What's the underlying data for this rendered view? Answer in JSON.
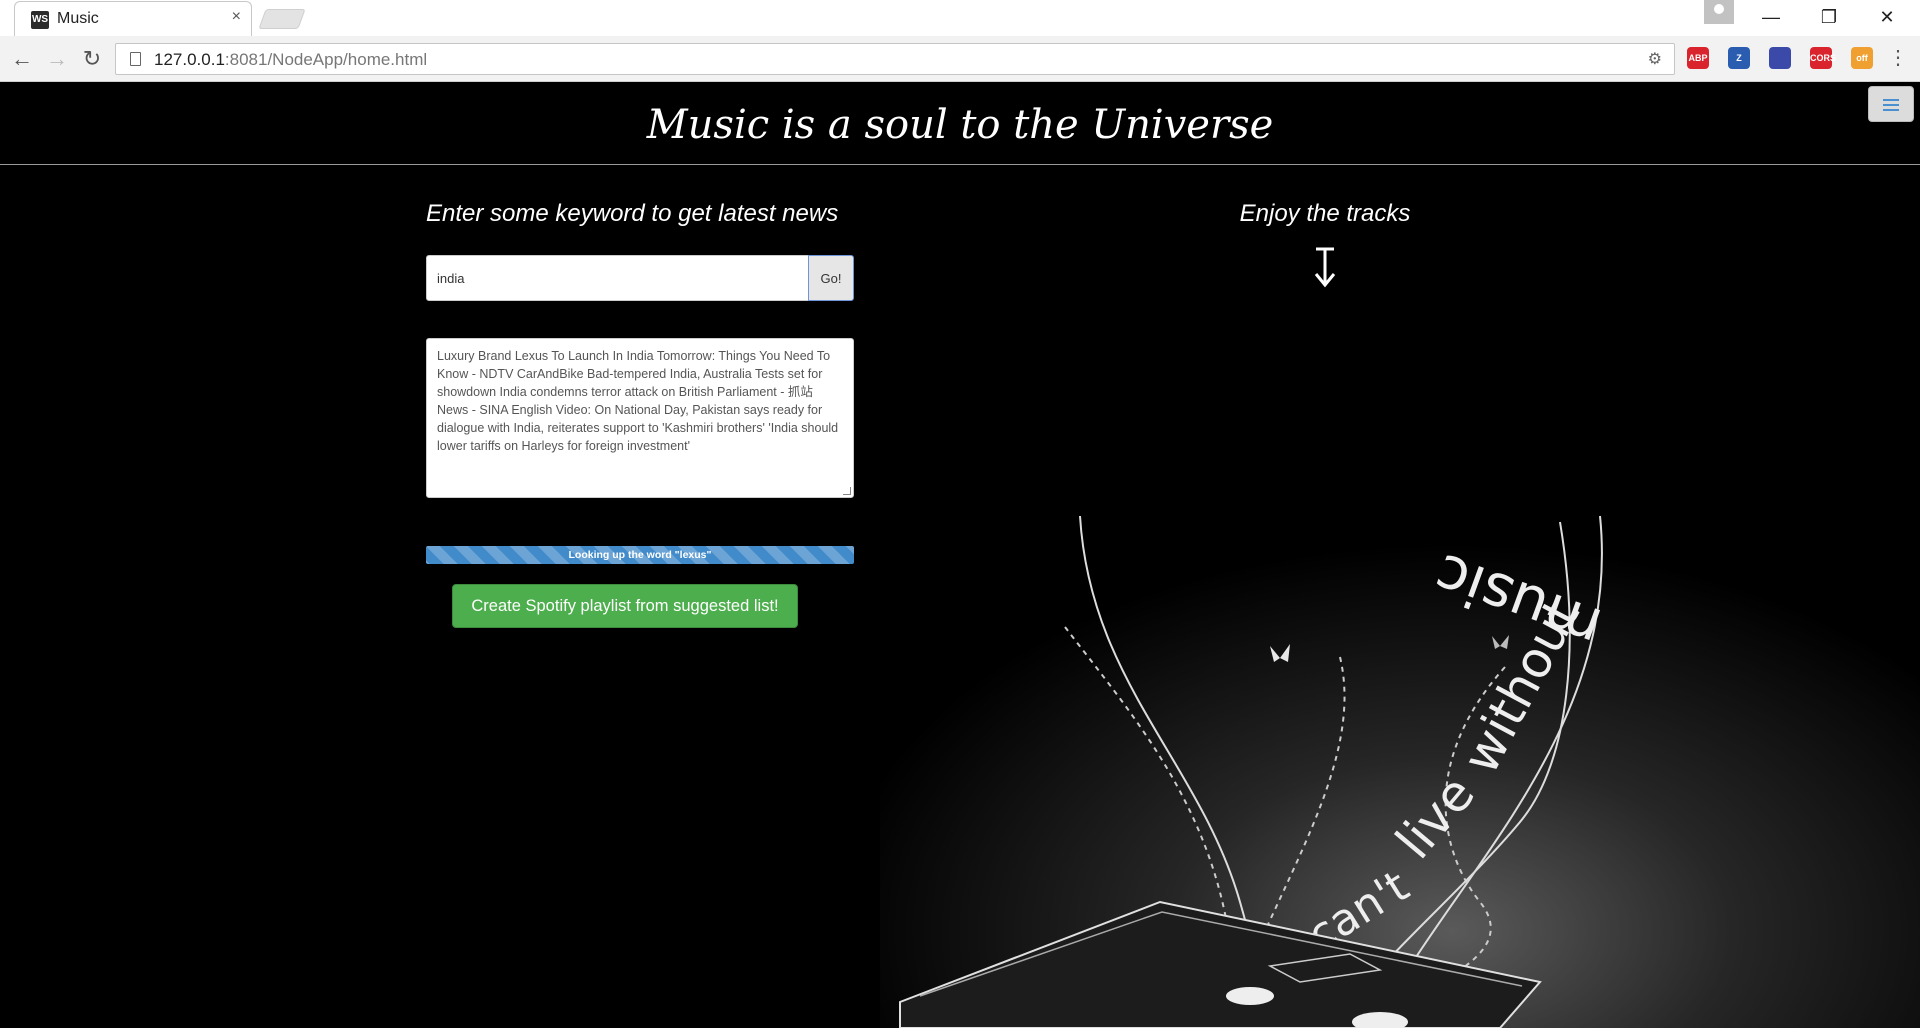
{
  "browser": {
    "tab_title": "Music",
    "tab_favicon": "WS",
    "close_glyph": "×",
    "url_host": "127.0.0.1",
    "url_rest": ":8081/NodeApp/home.html",
    "extensions": [
      {
        "name": "adblock-plus-icon",
        "text": "ABP",
        "color": "#d9232d"
      },
      {
        "name": "zotero-icon",
        "text": "Z",
        "color": "#2a5db0"
      },
      {
        "name": "extension-icon",
        "text": "",
        "color": "#3b4aa8"
      },
      {
        "name": "cors-icon",
        "text": "CORS",
        "color": "#d9232d"
      },
      {
        "name": "off-badge-extension-icon",
        "text": "off",
        "color": "#f0a030"
      }
    ]
  },
  "page": {
    "title": "Music is a soul to the Universe",
    "news_heading": "Enter some keyword to get latest news",
    "search_value": "india",
    "go_label": "Go!",
    "news_text": "Luxury Brand Lexus To Launch In India Tomorrow: Things You Need To Know - NDTV CarAndBike Bad-tempered India, Australia Tests set for showdown India condemns terror attack on British Parliament - 抓站 News - SINA English Video: On National Day, Pakistan says ready for dialogue with India, reiterates support to 'Kashmiri brothers' 'India should lower tariffs on Harleys for foreign investment'",
    "progress_label": "Looking up the word \"lexus\"",
    "progress_percent": 100,
    "spotify_label": "Create Spotify playlist from suggested list!",
    "tracks_heading": "Enjoy the tracks",
    "art_words": [
      "can't",
      "live",
      "without",
      "music"
    ]
  }
}
